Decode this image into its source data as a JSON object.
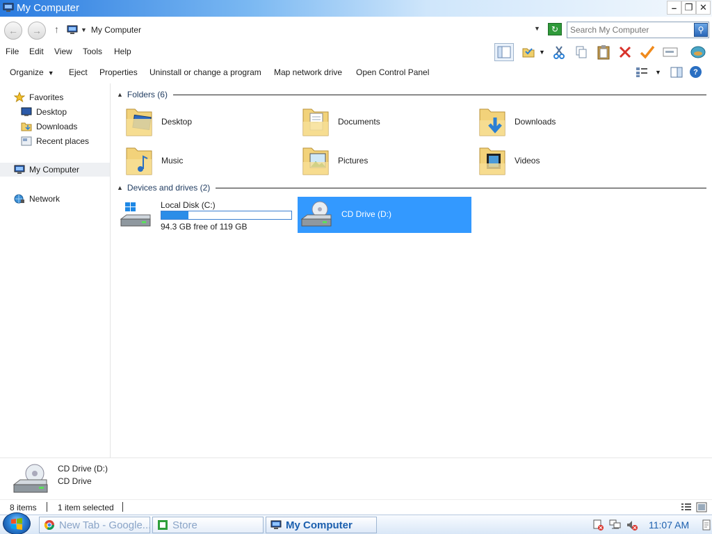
{
  "window": {
    "title": "My Computer"
  },
  "address": {
    "location": "My Computer",
    "search_placeholder": "Search My Computer"
  },
  "menu": [
    "File",
    "Edit",
    "View",
    "Tools",
    "Help"
  ],
  "commands": {
    "organize": "Organize",
    "eject": "Eject",
    "properties": "Properties",
    "uninstall": "Uninstall or change a program",
    "map_drive": "Map network drive",
    "control_panel": "Open Control Panel"
  },
  "nav": {
    "favorites": "Favorites",
    "desktop": "Desktop",
    "downloads": "Downloads",
    "recent": "Recent places",
    "computer": "My Computer",
    "network": "Network"
  },
  "groups": {
    "folders_label": "Folders (6)",
    "devices_label": "Devices and drives (2)"
  },
  "folders": [
    "Desktop",
    "Documents",
    "Downloads",
    "Music",
    "Pictures",
    "Videos"
  ],
  "drives": {
    "c_name": "Local Disk (C:)",
    "c_free": "94.3 GB free of 119 GB",
    "c_used_fraction": 0.21,
    "d_name": "CD Drive (D:)"
  },
  "details": {
    "name": "CD Drive (D:)",
    "type": "CD Drive"
  },
  "status": {
    "items": "8 items",
    "selected": "1 item selected"
  },
  "taskbar": {
    "tasks": [
      "New Tab - Google...",
      "Store",
      "My Computer"
    ],
    "clock": "11:07 AM"
  },
  "colors": {
    "selection": "#3399ff",
    "title_gradient_start": "#2a7be0",
    "disk_bar": "#2b8de8"
  }
}
